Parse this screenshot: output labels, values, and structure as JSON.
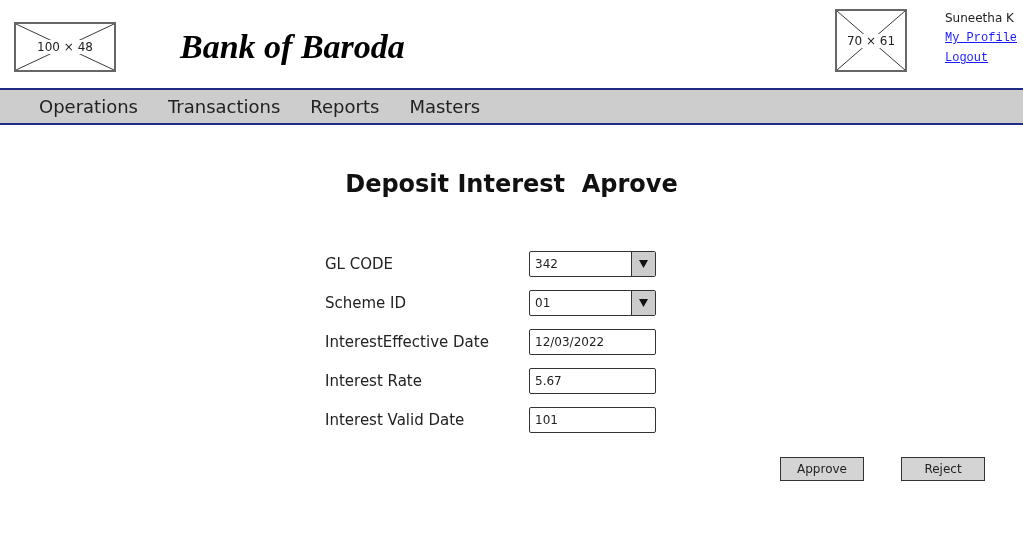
{
  "header": {
    "logo_placeholder": "100 × 48",
    "bank_name": "Bank of Baroda",
    "image_placeholder": "70 × 61",
    "user_name": "Suneetha K",
    "links": [
      "My Profile",
      "Logout"
    ]
  },
  "nav": [
    "Operations",
    "Transactions",
    "Reports",
    "Masters"
  ],
  "page_title": "Deposit Interest  Aprove",
  "fields": [
    {
      "label": "GL CODE",
      "kind": "select",
      "value": "342"
    },
    {
      "label": "Scheme ID",
      "kind": "select",
      "value": "01"
    },
    {
      "label": "InterestEffective Date",
      "kind": "text",
      "value": "12/03/2022"
    },
    {
      "label": "Interest Rate",
      "kind": "text",
      "value": "5.67"
    },
    {
      "label": "Interest Valid Date",
      "kind": "text",
      "value": "101"
    }
  ],
  "buttons": [
    "Approve",
    "Reject"
  ]
}
